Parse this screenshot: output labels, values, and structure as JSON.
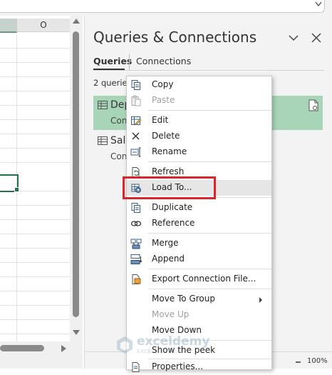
{
  "sheet": {
    "column_n": "",
    "column_o": "O"
  },
  "pane": {
    "title": "Queries & Connections",
    "tabs": [
      {
        "label": "Queries"
      },
      {
        "label": "Connections"
      }
    ],
    "query_count": "2 queries",
    "queries": [
      {
        "name": "Dep",
        "sub": "Con"
      },
      {
        "name": "Sala",
        "sub": "Con"
      }
    ],
    "zoom_percent": "100%"
  },
  "context_menu": {
    "items": [
      {
        "label": "Copy",
        "icon": "copy-icon"
      },
      {
        "label": "Paste",
        "icon": "paste-icon"
      },
      {
        "label": "Edit",
        "icon": "edit-icon"
      },
      {
        "label": "Delete",
        "icon": "delete-icon"
      },
      {
        "label": "Rename",
        "icon": "rename-icon"
      },
      {
        "label": "Refresh",
        "icon": "refresh-icon"
      },
      {
        "label": "Load To...",
        "icon": "load-to-icon"
      },
      {
        "label": "Duplicate",
        "icon": "duplicate-icon"
      },
      {
        "label": "Reference",
        "icon": "reference-icon"
      },
      {
        "label": "Merge",
        "icon": "merge-icon"
      },
      {
        "label": "Append",
        "icon": "append-icon"
      },
      {
        "label": "Export Connection File...",
        "icon": "export-connection-icon"
      },
      {
        "label": "Move To Group"
      },
      {
        "label": "Move Up"
      },
      {
        "label": "Move Down"
      },
      {
        "label": "Show the peek"
      },
      {
        "label": "Properties..."
      }
    ]
  },
  "watermark": {
    "name": "exceldemy",
    "tagline": "EXCEL · DATA · BI"
  },
  "colors": {
    "selected_query": "#a8d5b8",
    "highlight_box": "#d9262c",
    "active_cell": "#217346"
  }
}
